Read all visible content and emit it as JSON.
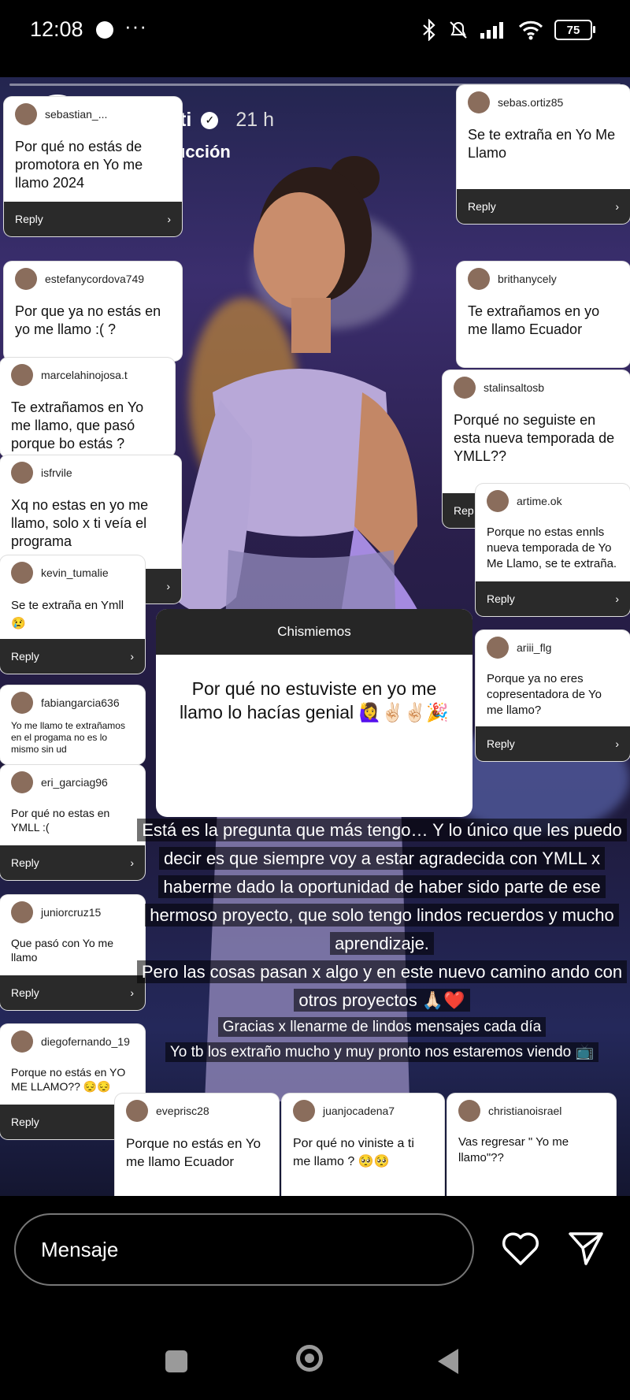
{
  "status": {
    "time": "12:08",
    "battery": "75"
  },
  "story": {
    "username": "valeriagutti",
    "age": "21 h",
    "translate": "Ver traducción"
  },
  "cards": [
    {
      "user": "sebastian_...",
      "question": "Por qué no estás de promotora en Yo me llamo 2024",
      "reply": "Reply"
    },
    {
      "user": "sebas.ortiz85",
      "question": "Se te extraña en Yo Me Llamo",
      "reply": "Reply"
    },
    {
      "user": "estefanycordova749",
      "question": "Por que ya no estás en yo me llamo :( ?",
      "reply": ""
    },
    {
      "user": "brithanycely",
      "question": "Te extrañamos en yo me llamo Ecuador",
      "reply": ""
    },
    {
      "user": "marcelahinojosa.t",
      "question": "Te extrañamos en Yo me llamo, que pasó porque bo estás ? Estarás ?",
      "reply": ""
    },
    {
      "user": "stalinsaltosb",
      "question": "Porqué no seguiste en esta nueva temporada de YMLL??",
      "reply": "Rep"
    },
    {
      "user": "isfrvile",
      "question": "Xq no estas en yo me llamo, solo x ti veía el programa",
      "reply": ""
    },
    {
      "user": "artime.ok",
      "question": "Porque no estas ennls nueva temporada de Yo Me Llamo, se te extraña.",
      "reply": "Reply"
    },
    {
      "user": "kevin_tumalie",
      "question": "Se te extraña en Ymll😢",
      "reply": "Reply"
    },
    {
      "user": "ariii_flg",
      "question": "Porque ya no eres copresentadora de Yo me llamo?",
      "reply": "Reply"
    },
    {
      "user": "fabiangarcia636",
      "question": "Yo me llamo te extrañamos en el progama no es lo mismo sin ud",
      "reply": ""
    },
    {
      "user": "eri_garciag96",
      "question": "Por qué no estas en YMLL :(",
      "reply": "Reply"
    },
    {
      "user": "juniorcruz15",
      "question": "Que pasó con Yo me llamo",
      "reply": "Reply"
    },
    {
      "user": "diegofernando_19",
      "question": "Porque no estás en YO ME LLAMO?? 😔😔",
      "reply": "Reply"
    },
    {
      "user": "eveprisc28",
      "question": "Porque no estás  en Yo me llamo Ecuador",
      "reply": ""
    },
    {
      "user": "juanjocadena7",
      "question": "Por qué no viniste a ti me llamo ? 🥺🥺",
      "reply": ""
    },
    {
      "user": "christianoisrael",
      "question": "Vas regresar \" Yo me llamo\"??",
      "reply": ""
    }
  ],
  "central": {
    "title": "Chismiemos",
    "question": "Por qué no estuviste en yo me llamo lo hacías genial 🙋‍♀️✌🏻✌🏻🎉"
  },
  "caption": {
    "l1": "Está es la pregunta que más tengo… Y lo único que les puedo",
    "l2": "decir es que siempre voy a estar agradecida con YMLL x",
    "l3": "haberme dado la oportunidad de haber sido parte de ese",
    "l4": "hermoso proyecto, que solo tengo lindos recuerdos y mucho",
    "l5": "aprendizaje.",
    "l6": "Pero las cosas pasan x algo y en este nuevo camino ando con",
    "l7": "otros proyectos 🙏🏻❤️",
    "l8": "Gracias x llenarme de lindos mensajes cada día",
    "l9": "Yo tb los extraño mucho y muy pronto nos estaremos viendo 📺"
  },
  "composer": {
    "placeholder": "Mensaje"
  }
}
